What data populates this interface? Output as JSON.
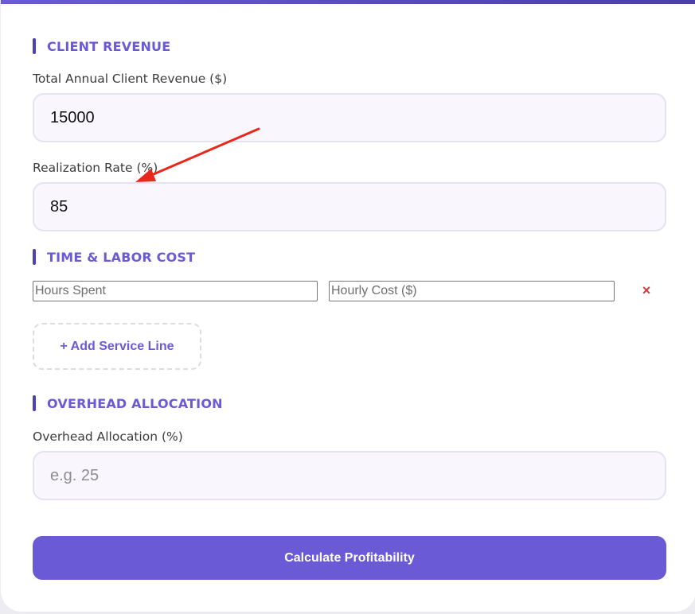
{
  "client_revenue": {
    "section_title": "CLIENT REVENUE",
    "revenue_label": "Total Annual Client Revenue ($)",
    "revenue_value": "15000",
    "realization_label": "Realization Rate (%)",
    "realization_value": "85"
  },
  "time_labor": {
    "section_title": "TIME & LABOR COST",
    "hours_placeholder": "Hours Spent",
    "hourly_cost_placeholder": "Hourly Cost ($)",
    "remove_label": "×",
    "add_button_label": "+ Add Service Line"
  },
  "overhead": {
    "section_title": "OVERHEAD ALLOCATION",
    "label": "Overhead Allocation (%)",
    "placeholder": "e.g. 25"
  },
  "calculate_button_label": "Calculate Profitability",
  "colors": {
    "accent": "#6a5ad6",
    "annotation_arrow": "#e8281c",
    "remove": "#d43a3a"
  },
  "icons": {
    "remove": "close-icon",
    "annotation": "red-arrow-annotation"
  }
}
